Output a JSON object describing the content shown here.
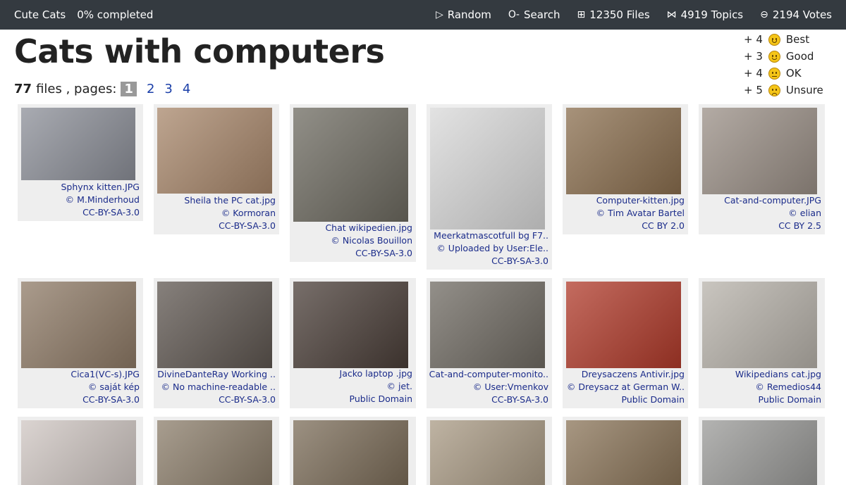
{
  "nav": {
    "site_title": "Cute Cats",
    "progress": "0% completed",
    "random": {
      "icon": "play-icon",
      "label": "Random"
    },
    "search": {
      "icon": "key-icon",
      "label": "Search"
    },
    "files": {
      "icon": "grid-icon",
      "label": "12350 Files"
    },
    "topics": {
      "icon": "bowtie-icon",
      "label": "4919 Topics"
    },
    "votes": {
      "icon": "ballot-icon",
      "label": "2194 Votes"
    }
  },
  "page_title": "Cats with computers",
  "summary": {
    "count": "77",
    "files_label": "files , pages:",
    "pages": [
      "1",
      "2",
      "3",
      "4"
    ]
  },
  "vote_options": [
    {
      "plus": "+ 4",
      "label": "Best",
      "icon": "grinning-face-icon"
    },
    {
      "plus": "+ 3",
      "label": "Good",
      "icon": "smiling-face-icon"
    },
    {
      "plus": "+ 4",
      "label": "OK",
      "icon": "neutral-face-icon"
    },
    {
      "plus": "+ 5",
      "label": "Unsure",
      "icon": "confused-face-icon"
    }
  ],
  "cards": [
    {
      "file": "Sphynx kitten.JPG",
      "author": "© M.Minderhoud",
      "license": "CC-BY-SA-3.0",
      "color": "#8c8f98"
    },
    {
      "file": "Sheila the PC cat.jpg",
      "author": "© Kormoran",
      "license": "CC-BY-SA-3.0",
      "color": "#a8876b"
    },
    {
      "file": "Chat wikipedien.jpg",
      "author": "© Nicolas Bouillon",
      "license": "CC-BY-SA-3.0",
      "color": "#6d6a60"
    },
    {
      "file": "Meerkatmascotfull bg F7..",
      "author": "© Uploaded by User:Ele..",
      "license": "CC-BY-SA-3.0",
      "color": "#d9d9d9"
    },
    {
      "file": "Computer-kitten.jpg",
      "author": "© Tim Avatar Bartel",
      "license": "CC BY 2.0",
      "color": "#8a6e4e"
    },
    {
      "file": "Cat-and-computer.JPG",
      "author": "© elian",
      "license": "CC BY 2.5",
      "color": "#9a8f86"
    },
    {
      "file": "Cica1(VC-s).JPG",
      "author": "© saját kép",
      "license": "CC-BY-SA-3.0",
      "color": "#8e7a66"
    },
    {
      "file": "DivineDanteRay Working ..",
      "author": "© No machine-readable ..",
      "license": "CC-BY-SA-3.0",
      "color": "#5e5650"
    },
    {
      "file": "Jacko laptop .jpg",
      "author": "© jet.",
      "license": "Public Domain",
      "color": "#4a3e38"
    },
    {
      "file": "Cat-and-computer-monito..",
      "author": "© User:Vmenkov",
      "license": "CC-BY-SA-3.0",
      "color": "#6f6a62"
    },
    {
      "file": "Dreysaczens Antivir.jpg",
      "author": "© Dreysacz at German W..",
      "license": "Public Domain",
      "color": "#b03a2a"
    },
    {
      "file": "Wikipedians cat.jpg",
      "author": "© Remedios44",
      "license": "Public Domain",
      "color": "#b7b2aa"
    },
    {
      "color": "#cfc6c2"
    },
    {
      "color": "#8b7d6a"
    },
    {
      "color": "#7b6c58"
    },
    {
      "color": "#a99a84"
    },
    {
      "color": "#8a7458"
    },
    {
      "color": "#9a9a98"
    }
  ]
}
